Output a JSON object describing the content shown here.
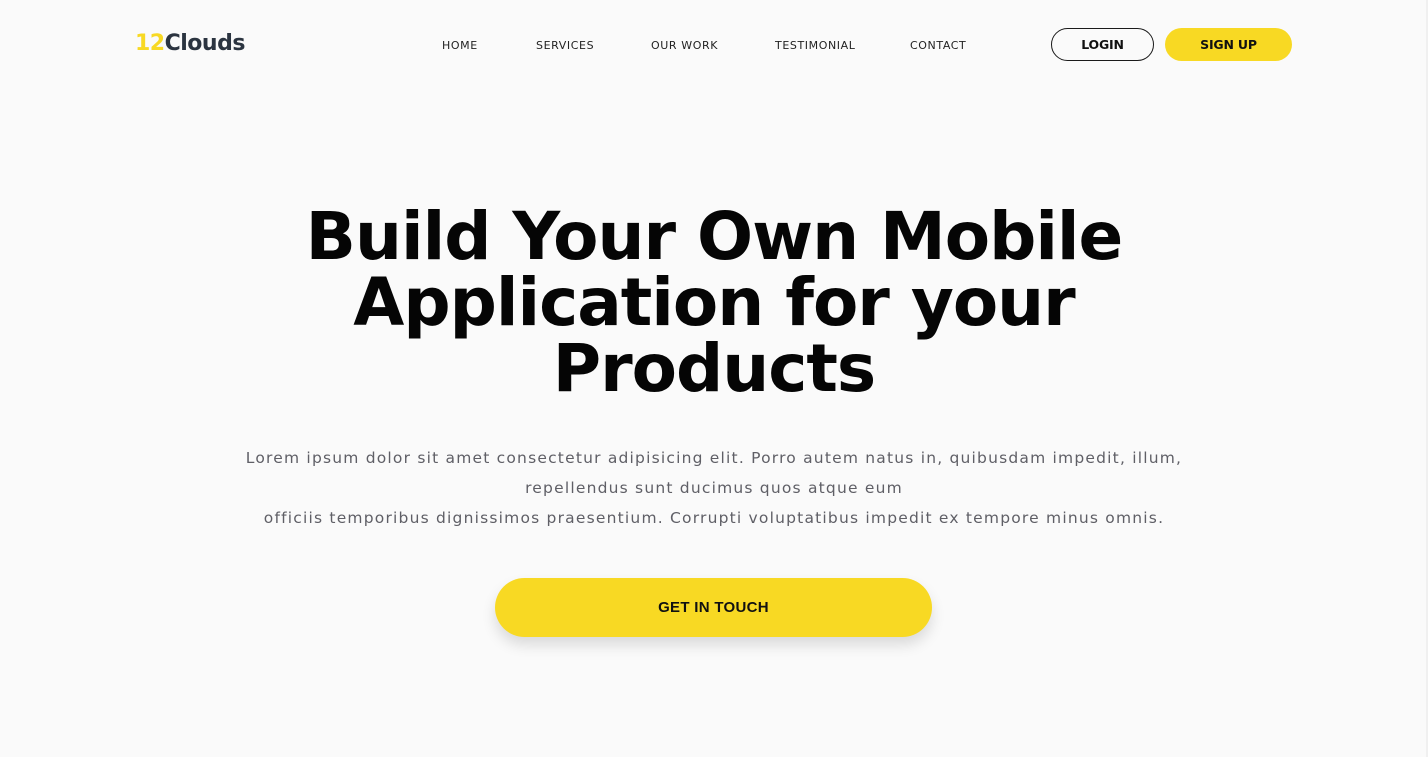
{
  "brand": {
    "logo_number": "12",
    "logo_word": "Clouds",
    "accent_color": "#f8d923",
    "logo_word_color": "#2b3440"
  },
  "nav": {
    "items": [
      "HOME",
      "SERVICES",
      "OUR WORK",
      "TESTIMONIAL",
      "CONTACT"
    ]
  },
  "auth": {
    "login_label": "LOGIN",
    "signup_label": "SIGN UP"
  },
  "hero": {
    "title_lines": [
      "Build Your Own Mobile",
      "Application for your",
      "Products"
    ],
    "subtitle_lines": [
      "Lorem ipsum dolor sit amet consectetur adipisicing elit. Porro autem natus in, quibusdam impedit, illum,",
      "repellendus sunt ducimus quos atque eum",
      "officiis temporibus dignissimos praesentium. Corrupti voluptatibus impedit ex tempore minus omnis."
    ],
    "cta_label": "GET IN TOUCH"
  }
}
